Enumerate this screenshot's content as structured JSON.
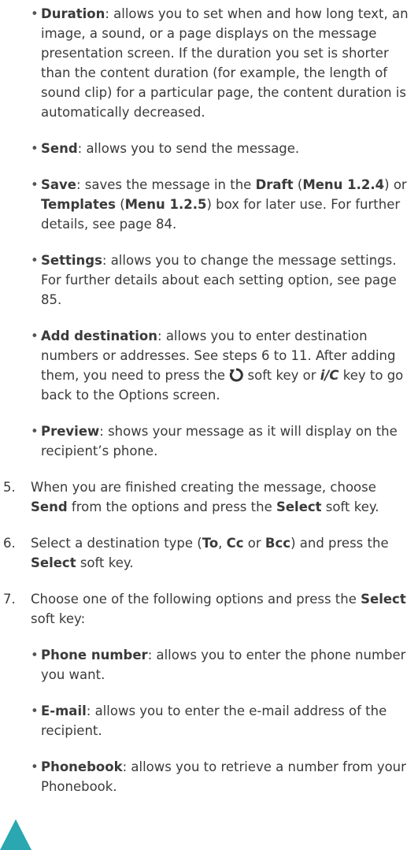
{
  "options_bullets": [
    {
      "term": "Duration",
      "text": ": allows you to set when and how long text, an image, a sound, or a page displays on the message presentation screen. If the duration you set is shorter than the content duration (for example, the length of sound clip) for a particular page, the content duration is automatically decreased."
    },
    {
      "term": "Send",
      "text": ": allows you to send the message."
    },
    {
      "term": "Save",
      "parts": [
        ": saves the message in the ",
        "Draft",
        " (",
        "Menu 1.2.4",
        ") or ",
        "Templates",
        " (",
        "Menu 1.2.5",
        ") box for later use. For further details, see page 84."
      ]
    },
    {
      "term": "Settings",
      "text": ": allows you to change the message settings. For further details about each setting option, see page 85."
    },
    {
      "term": "Add destination",
      "text_a": ": allows you to enter destination numbers or addresses. See steps 6 to 11. After adding them, you need to press the ",
      "icon1": "back-soft-key-icon",
      "text_b": " soft key or ",
      "key_label": "i/C",
      "text_c": " key to go back to the Options screen."
    },
    {
      "term": "Preview",
      "text": ": shows your message as it will display on the recipient’s phone."
    }
  ],
  "steps": [
    {
      "num": "5.",
      "t1": "When you are finished creating the message, choose ",
      "b1": "Send",
      "t2": " from the options and press the ",
      "b2": "Select",
      "t3": " soft key."
    },
    {
      "num": "6.",
      "t1": "Select a destination type (",
      "b1": "To",
      "t2": ", ",
      "b2": "Cc",
      "t3": " or ",
      "b3": "Bcc",
      "t4": ") and press the ",
      "b4": "Select",
      "t5": " soft key."
    },
    {
      "num": "7.",
      "t1": "Choose one of the following options and press the ",
      "b1": "Select",
      "t2": " soft key:"
    }
  ],
  "recipient_bullets": [
    {
      "term": "Phone number",
      "text": ": allows you to enter the phone number you want."
    },
    {
      "term": "E-mail",
      "text": ": allows you to enter the e-mail address of the recipient."
    },
    {
      "term": "Phonebook",
      "text": ": allows you to retrieve a number from your Phonebook."
    }
  ],
  "colors": {
    "text": "#3a3a3a",
    "accent_tab": "#2aa7b0"
  }
}
